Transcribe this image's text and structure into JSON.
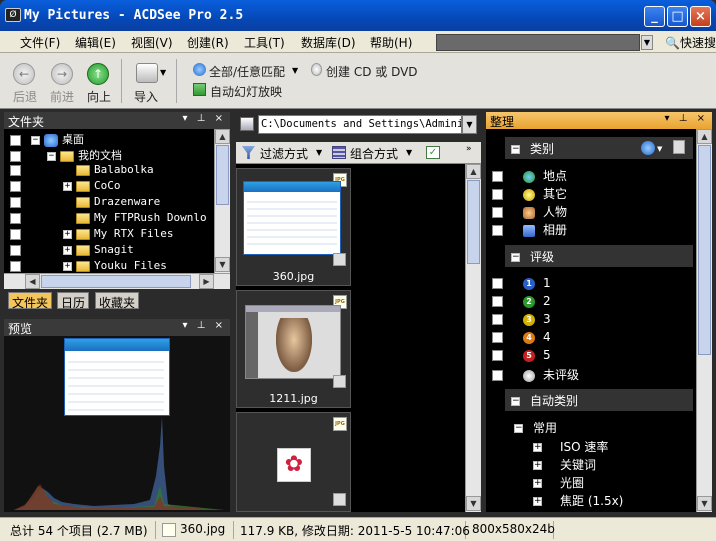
{
  "window": {
    "title": "My Pictures - ACDSee Pro 2.5"
  },
  "menu": [
    "文件(F)",
    "编辑(E)",
    "视图(V)",
    "创建(R)",
    "工具(T)",
    "数据库(D)",
    "帮助(H)"
  ],
  "search": {
    "value": "",
    "button": "快速搜"
  },
  "toolbar": {
    "back": "后退",
    "forward": "前进",
    "up": "向上",
    "import": "导入",
    "match": "全部/任意匹配",
    "create_cd": "创建 CD 或 DVD",
    "slideshow": "自动幻灯放映"
  },
  "folders": {
    "title": "文件夹",
    "items": [
      "桌面",
      "我的文档",
      "Balabolka",
      "CoCo",
      "Drazenware",
      "My FTPRush Downlo",
      "My RTX Files",
      "Snagit",
      "Youku Files"
    ],
    "tabs": [
      "文件夹",
      "日历",
      "收藏夹"
    ]
  },
  "preview": {
    "title": "预览"
  },
  "browser": {
    "path": "C:\\Documents and Settings\\Adminis",
    "filter": "过滤方式",
    "group": "组合方式",
    "thumbs": [
      {
        "name": "360.jpg",
        "badge": "JPG"
      },
      {
        "name": "1211.jpg",
        "badge": "JPG"
      },
      {
        "name": "",
        "badge": "JPG"
      }
    ]
  },
  "organize": {
    "title": "整理",
    "categories": {
      "title": "类别",
      "items": [
        "地点",
        "其它",
        "人物",
        "相册"
      ]
    },
    "ratings": {
      "title": "评级",
      "items": [
        "1",
        "2",
        "3",
        "4",
        "5",
        "未评级"
      ]
    },
    "auto": {
      "title": "自动类别",
      "group": "常用",
      "items": [
        "ISO 速率",
        "关键词",
        "光圈",
        "焦距 (1.5x)"
      ]
    }
  },
  "status": {
    "total": "总计 54 个项目 (2.7 MB)",
    "file": "360.jpg",
    "info": "117.9 KB, 修改日期: 2011-5-5 10:47:06",
    "dims": "800x580x24b"
  }
}
